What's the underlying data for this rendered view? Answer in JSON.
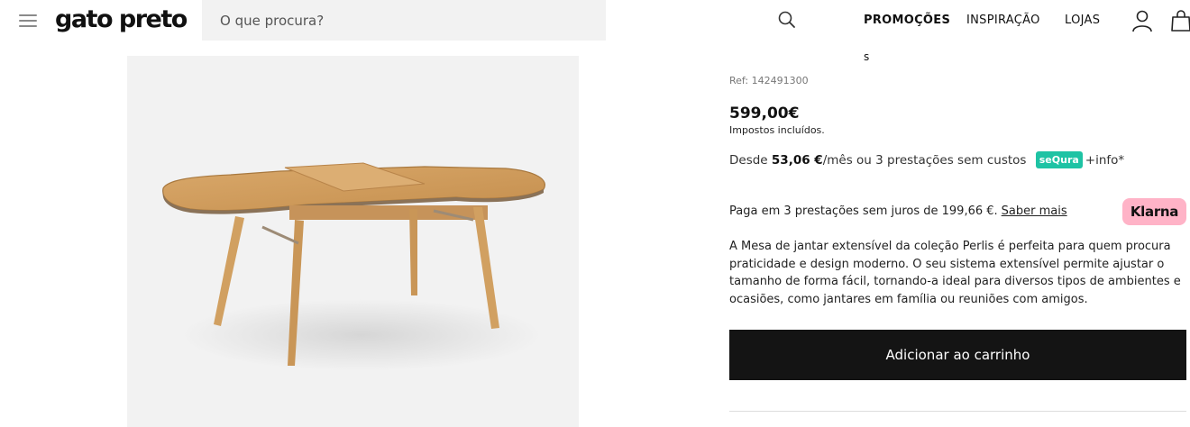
{
  "header": {
    "logo": "gato preto",
    "search_placeholder": "O que procura?",
    "nav": [
      "PROMOÇÕES",
      "INSPIRAÇÃO",
      "LOJAS"
    ]
  },
  "product": {
    "title_fragment": "s",
    "ref": "Ref: 142491300",
    "price": "599,00€",
    "tax_note": "Impostos incluídos.",
    "installment": {
      "prefix": "Desde",
      "amount": "53,06 €",
      "suffix": "/mês ou 3 prestações sem custos",
      "badge": "seQura",
      "info": "+info*"
    },
    "klarna": {
      "text": "Paga em 3 prestações sem juros de 199,66 €.",
      "link": "Saber mais",
      "badge": "Klarna"
    },
    "description": "A Mesa de jantar extensível da coleção Perlis é perfeita para quem procura praticidade e design moderno. O seu sistema extensível permite ajustar o tamanho de forma fácil, tornando-a ideal para diversos tipos de ambientes e ocasiões, como jantares em família ou reuniões com amigos.",
    "add_to_cart": "Adicionar ao carrinho"
  },
  "colors": {
    "sequra": "#1ec3a4",
    "klarna": "#ffb3c7",
    "button": "#141414",
    "image_bg": "#f2f2f2"
  },
  "icons": [
    "menu-icon",
    "search-icon",
    "user-icon",
    "shopping-bag-icon"
  ]
}
